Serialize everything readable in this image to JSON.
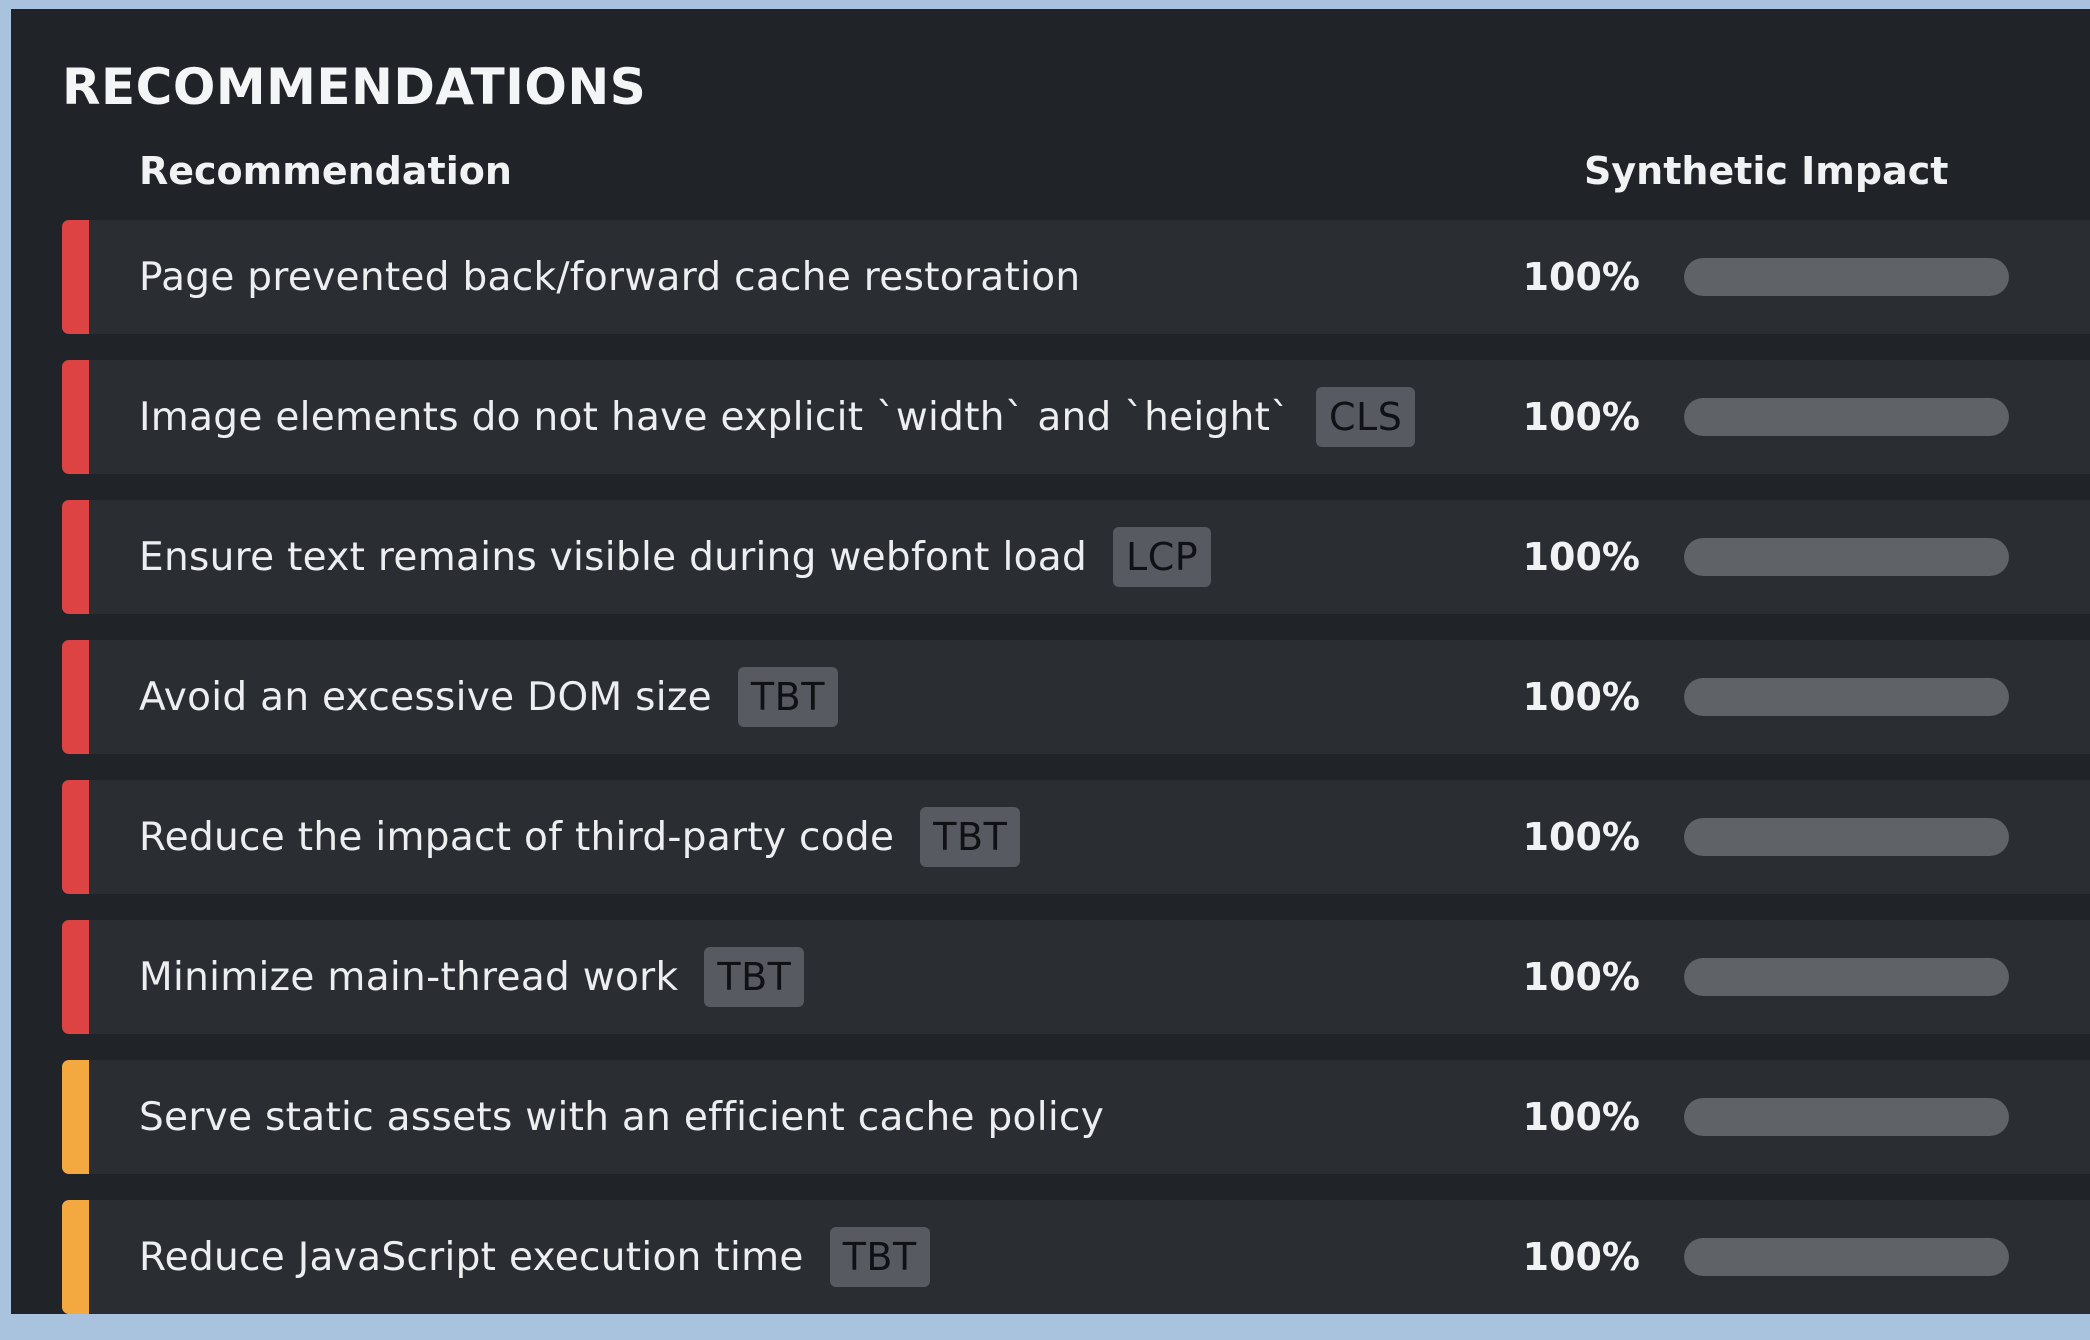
{
  "title": "RECOMMENDATIONS",
  "columns": {
    "recommendation": "Recommendation",
    "impact": "Synthetic Impact"
  },
  "colors": {
    "severity_high": "#dd4343",
    "severity_medium": "#f3a940",
    "background": "#202327",
    "row": "#2a2e33",
    "badge": "#575b61",
    "bar": "#5f6368"
  },
  "rows": [
    {
      "label": "Page prevented back/forward cache restoration",
      "badge": "",
      "severity": "high",
      "impact": "100%",
      "impact_fraction": 1.0
    },
    {
      "label": "Image elements do not have explicit `width` and `height`",
      "badge": "CLS",
      "severity": "high",
      "impact": "100%",
      "impact_fraction": 1.0
    },
    {
      "label": "Ensure text remains visible during webfont load",
      "badge": "LCP",
      "severity": "high",
      "impact": "100%",
      "impact_fraction": 1.0
    },
    {
      "label": "Avoid an excessive DOM size",
      "badge": "TBT",
      "severity": "high",
      "impact": "100%",
      "impact_fraction": 1.0
    },
    {
      "label": "Reduce the impact of third-party code",
      "badge": "TBT",
      "severity": "high",
      "impact": "100%",
      "impact_fraction": 1.0
    },
    {
      "label": "Minimize main-thread work",
      "badge": "TBT",
      "severity": "high",
      "impact": "100%",
      "impact_fraction": 1.0
    },
    {
      "label": "Serve static assets with an efficient cache policy",
      "badge": "",
      "severity": "medium",
      "impact": "100%",
      "impact_fraction": 1.0
    },
    {
      "label": "Reduce JavaScript execution time",
      "badge": "TBT",
      "severity": "medium",
      "impact": "100%",
      "impact_fraction": 1.0
    }
  ]
}
